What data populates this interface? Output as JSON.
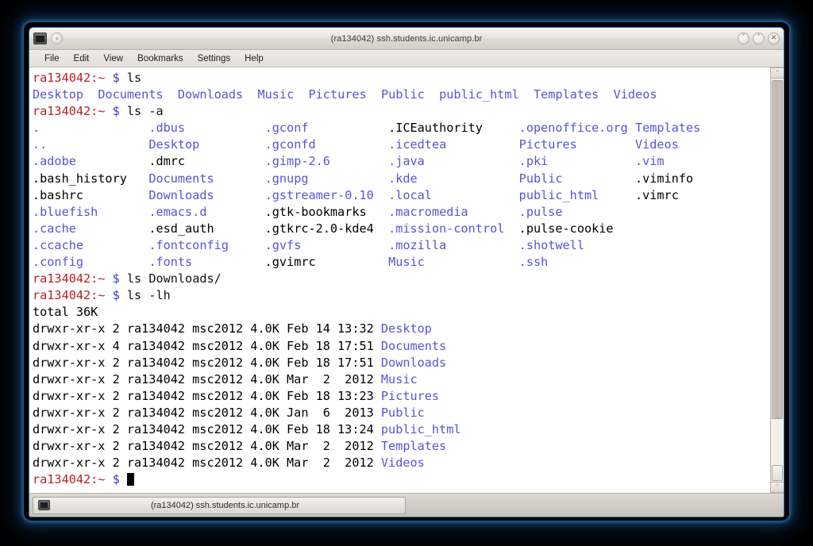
{
  "window": {
    "title": "(ra134042) ssh.students.ic.unicamp.br",
    "app_icon": "terminal-icon",
    "pin_icon": "pin-button-icon",
    "buttons": {
      "minimize": "ˇ",
      "maximize": "ˆ",
      "close": "✕"
    }
  },
  "menubar": {
    "items": [
      {
        "label": "File"
      },
      {
        "label": "Edit"
      },
      {
        "label": "View"
      },
      {
        "label": "Bookmarks"
      },
      {
        "label": "Settings"
      },
      {
        "label": "Help"
      }
    ]
  },
  "terminal": {
    "prompt": "ra134042:~",
    "dollar": "$",
    "colors": {
      "prompt_red": "#b92121",
      "dollar_blue": "#3a3ad0",
      "directory_blue": "#5555d4",
      "file_black": "#000000",
      "background": "#ffffff"
    },
    "commands": {
      "ls": "ls",
      "ls_a": "ls -a",
      "ls_downloads": "ls Downloads/",
      "ls_lh": "ls -lh"
    },
    "ls_output": [
      "Desktop",
      "Documents",
      "Downloads",
      "Music",
      "Pictures",
      "Public",
      "public_html",
      "Templates",
      "Videos"
    ],
    "ls_a_rows": [
      [
        {
          "t": ".",
          "k": "dir"
        },
        {
          "t": ".dbus",
          "k": "dir"
        },
        {
          "t": ".gconf",
          "k": "dir"
        },
        {
          "t": ".ICEauthority",
          "k": "file"
        },
        {
          "t": ".openoffice.org",
          "k": "dir"
        },
        {
          "t": "Templates",
          "k": "dir"
        }
      ],
      [
        {
          "t": "..",
          "k": "dir"
        },
        {
          "t": "Desktop",
          "k": "dir"
        },
        {
          "t": ".gconfd",
          "k": "dir"
        },
        {
          "t": ".icedtea",
          "k": "dir"
        },
        {
          "t": "Pictures",
          "k": "dir"
        },
        {
          "t": "Videos",
          "k": "dir"
        }
      ],
      [
        {
          "t": ".adobe",
          "k": "dir"
        },
        {
          "t": ".dmrc",
          "k": "file"
        },
        {
          "t": ".gimp-2.6",
          "k": "dir"
        },
        {
          "t": ".java",
          "k": "dir"
        },
        {
          "t": ".pki",
          "k": "dir"
        },
        {
          "t": ".vim",
          "k": "dir"
        }
      ],
      [
        {
          "t": ".bash_history",
          "k": "file"
        },
        {
          "t": "Documents",
          "k": "dir"
        },
        {
          "t": ".gnupg",
          "k": "dir"
        },
        {
          "t": ".kde",
          "k": "dir"
        },
        {
          "t": "Public",
          "k": "dir"
        },
        {
          "t": ".viminfo",
          "k": "file"
        }
      ],
      [
        {
          "t": ".bashrc",
          "k": "file"
        },
        {
          "t": "Downloads",
          "k": "dir"
        },
        {
          "t": ".gstreamer-0.10",
          "k": "dir"
        },
        {
          "t": ".local",
          "k": "dir"
        },
        {
          "t": "public_html",
          "k": "dir"
        },
        {
          "t": ".vimrc",
          "k": "file"
        }
      ],
      [
        {
          "t": ".bluefish",
          "k": "dir"
        },
        {
          "t": ".emacs.d",
          "k": "dir"
        },
        {
          "t": ".gtk-bookmarks",
          "k": "file"
        },
        {
          "t": ".macromedia",
          "k": "dir"
        },
        {
          "t": ".pulse",
          "k": "dir"
        },
        {
          "t": "",
          "k": "file"
        }
      ],
      [
        {
          "t": ".cache",
          "k": "dir"
        },
        {
          "t": ".esd_auth",
          "k": "file"
        },
        {
          "t": ".gtkrc-2.0-kde4",
          "k": "file"
        },
        {
          "t": ".mission-control",
          "k": "dir"
        },
        {
          "t": ".pulse-cookie",
          "k": "file"
        },
        {
          "t": "",
          "k": "file"
        }
      ],
      [
        {
          "t": ".ccache",
          "k": "dir"
        },
        {
          "t": ".fontconfig",
          "k": "dir"
        },
        {
          "t": ".gvfs",
          "k": "dir"
        },
        {
          "t": ".mozilla",
          "k": "dir"
        },
        {
          "t": ".shotwell",
          "k": "dir"
        },
        {
          "t": "",
          "k": "file"
        }
      ],
      [
        {
          "t": ".config",
          "k": "dir"
        },
        {
          "t": ".fonts",
          "k": "dir"
        },
        {
          "t": ".gvimrc",
          "k": "file"
        },
        {
          "t": "Music",
          "k": "dir"
        },
        {
          "t": ".ssh",
          "k": "dir"
        },
        {
          "t": "",
          "k": "file"
        }
      ]
    ],
    "total_line": "total 36K",
    "ls_lh_rows": [
      {
        "perms": "drwxr-xr-x",
        "links": "2",
        "owner": "ra134042",
        "group": "msc2012",
        "size": "4.0K",
        "month": "Feb",
        "day": "14",
        "time": "13:32",
        "name": "Desktop"
      },
      {
        "perms": "drwxr-xr-x",
        "links": "4",
        "owner": "ra134042",
        "group": "msc2012",
        "size": "4.0K",
        "month": "Feb",
        "day": "18",
        "time": "17:51",
        "name": "Documents"
      },
      {
        "perms": "drwxr-xr-x",
        "links": "2",
        "owner": "ra134042",
        "group": "msc2012",
        "size": "4.0K",
        "month": "Feb",
        "day": "18",
        "time": "17:51",
        "name": "Downloads"
      },
      {
        "perms": "drwxr-xr-x",
        "links": "2",
        "owner": "ra134042",
        "group": "msc2012",
        "size": "4.0K",
        "month": "Mar",
        "day": "2",
        "time": "2012",
        "name": "Music"
      },
      {
        "perms": "drwxr-xr-x",
        "links": "2",
        "owner": "ra134042",
        "group": "msc2012",
        "size": "4.0K",
        "month": "Feb",
        "day": "18",
        "time": "13:23",
        "name": "Pictures"
      },
      {
        "perms": "drwxr-xr-x",
        "links": "2",
        "owner": "ra134042",
        "group": "msc2012",
        "size": "4.0K",
        "month": "Jan",
        "day": "6",
        "time": "2013",
        "name": "Public"
      },
      {
        "perms": "drwxr-xr-x",
        "links": "2",
        "owner": "ra134042",
        "group": "msc2012",
        "size": "4.0K",
        "month": "Feb",
        "day": "18",
        "time": "13:24",
        "name": "public_html"
      },
      {
        "perms": "drwxr-xr-x",
        "links": "2",
        "owner": "ra134042",
        "group": "msc2012",
        "size": "4.0K",
        "month": "Mar",
        "day": "2",
        "time": "2012",
        "name": "Templates"
      },
      {
        "perms": "drwxr-xr-x",
        "links": "2",
        "owner": "ra134042",
        "group": "msc2012",
        "size": "4.0K",
        "month": "Mar",
        "day": "2",
        "time": "2012",
        "name": "Videos"
      }
    ]
  },
  "scrollbar": {
    "up_arrow": "ˆ",
    "down_arrow": "ˇ"
  },
  "taskbar": {
    "button_label": "(ra134042) ssh.students.ic.unicamp.br",
    "icon": "terminal-icon"
  }
}
